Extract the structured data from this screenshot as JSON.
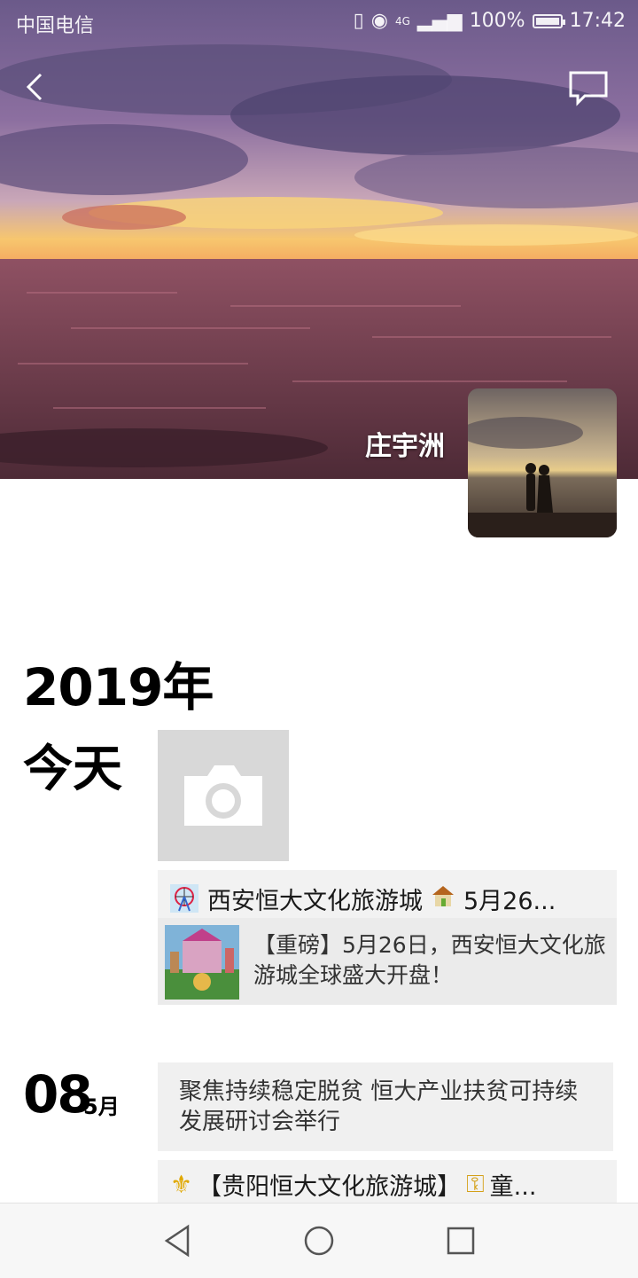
{
  "status_bar": {
    "carrier": "中国电信",
    "network": "4G",
    "battery": "100%",
    "time": "17:42"
  },
  "header": {
    "user_name": "庄宇洲"
  },
  "timeline": {
    "year": "2019年",
    "today_label": "今天",
    "shared_post": {
      "title": "西安恒大文化旅游城",
      "title_tail": "5月26...",
      "card_text": "【重磅】5月26日，西安恒大文化旅游城全球盛大开盘！"
    },
    "entry2": {
      "day": "08",
      "month": "5月",
      "text": "聚焦持续稳定脱贫 恒大产业扶贫可持续发展研讨会举行"
    },
    "shared_post2": {
      "title": "【贵阳恒大文化旅游城】",
      "title_tail": "童..."
    }
  },
  "colors": {
    "tile_gray": "#d8d8d8",
    "post_bg": "#f2f2f2"
  }
}
